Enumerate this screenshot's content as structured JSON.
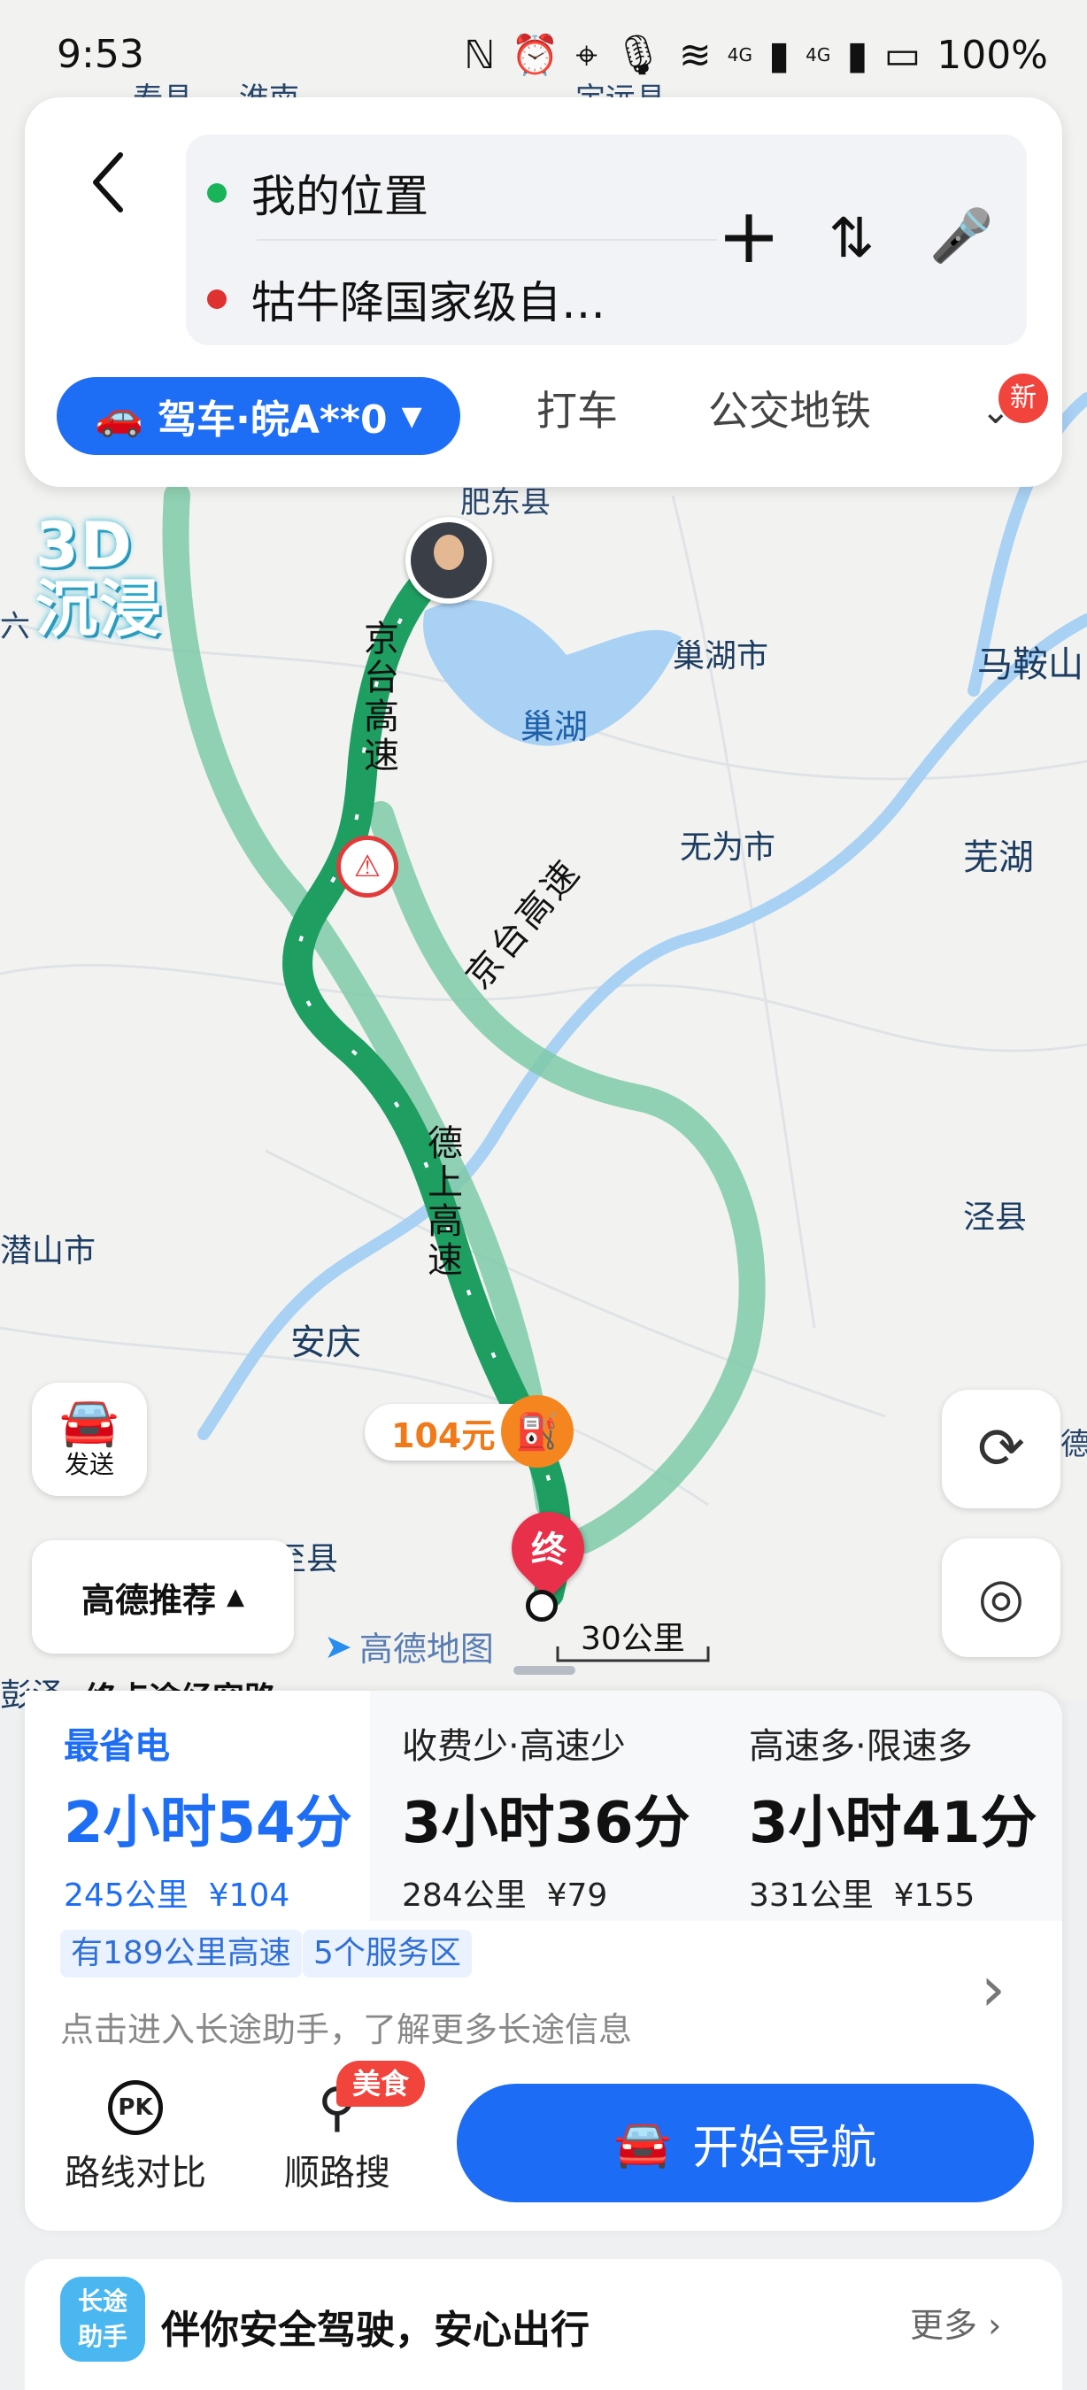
{
  "status_bar": {
    "time": "9:53",
    "battery": "100%",
    "network1": "4G",
    "network2": "4G"
  },
  "search": {
    "origin": "我的位置",
    "destination": "牯牛降国家级自…",
    "colors": {
      "origin_dot": "#19b35a",
      "destination_dot": "#e03131"
    }
  },
  "modes": {
    "drive": "驾车·皖A**0",
    "taxi": "打车",
    "transit": "公交地铁",
    "new_badge": "新"
  },
  "map": {
    "badge_3d_line1": "3D",
    "badge_3d_line2": "沉浸",
    "labels": {
      "feidong": "肥东县",
      "chaohu_city": "巢湖市",
      "chaohu_lake": "巢湖",
      "maanshan": "马鞍山",
      "wuwei": "无为市",
      "wuhu": "芜湖",
      "qianshan": "潜山市",
      "anqing": "安庆",
      "jingxian": "泾县",
      "dongzhi": "东至县",
      "pengze": "彭泽",
      "top_left": "寿县",
      "top_mid": "淮南",
      "top_right": "定远县",
      "lu": "六",
      "right_edge": "德"
    },
    "roads": {
      "jingtai_1": "京台高速",
      "jingtai_2": "京台高速",
      "deshang": "德上高速"
    },
    "toll": "104元",
    "end_marker": "终",
    "scale": "30公里",
    "brand": "高德地图",
    "send_label": "发送",
    "recommend": "高德推荐",
    "peek_text": "终点途经容路"
  },
  "routes": [
    {
      "label": "最省电",
      "time": "2小时54分",
      "distance": "245公里",
      "cost": "¥104",
      "selected": true
    },
    {
      "label": "收费少·高速少",
      "time": "3小时36分",
      "distance": "284公里",
      "cost": "¥79",
      "selected": false
    },
    {
      "label": "高速多·限速多",
      "time": "3小时41分",
      "distance": "331公里",
      "cost": "¥155",
      "selected": false
    }
  ],
  "tags": {
    "highway": "有189公里高速",
    "service": "5个服务区"
  },
  "hint": "点击进入长途助手，了解更多长途信息",
  "actions": {
    "compare": "路线对比",
    "search_along": "顺路搜",
    "food_badge": "美食",
    "start": "开始导航"
  },
  "promo": {
    "icon_text_1": "长途",
    "icon_text_2": "助手",
    "text": "伴你安全驾驶，安心出行",
    "more": "更多"
  },
  "colors": {
    "accent": "#1e6ef5",
    "route_main": "#1f9e62",
    "route_alt": "#7fcaa8",
    "water": "#a9d1f4"
  }
}
